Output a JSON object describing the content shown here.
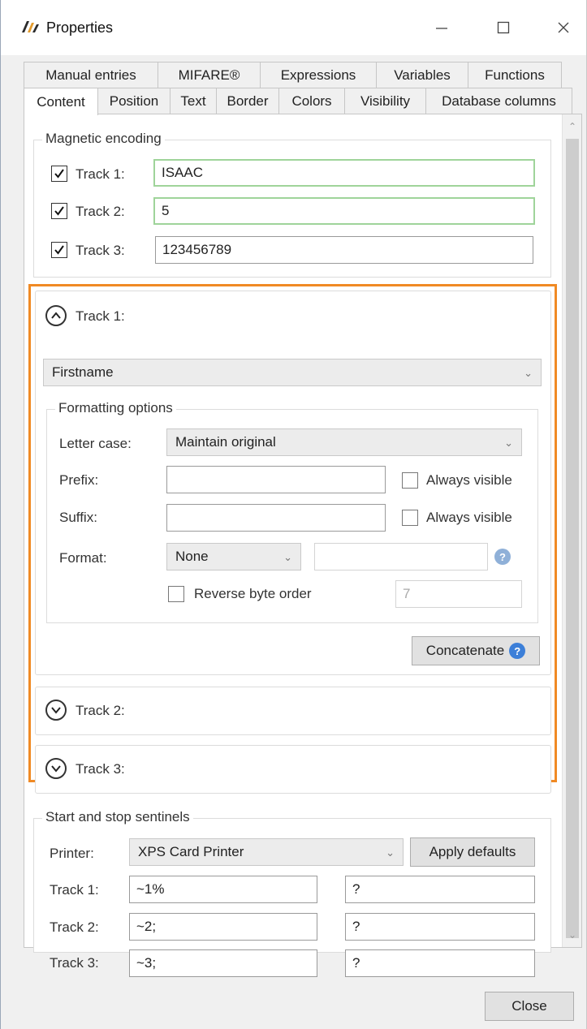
{
  "window": {
    "title": "Properties"
  },
  "tabs": {
    "back": [
      "Manual entries",
      "MIFARE®",
      "Expressions",
      "Variables",
      "Functions"
    ],
    "front": [
      "Content",
      "Position",
      "Text",
      "Border",
      "Colors",
      "Visibility",
      "Database columns"
    ]
  },
  "magnetic": {
    "title": "Magnetic encoding",
    "tracks": [
      {
        "label": "Track 1:",
        "value": "ISAAC"
      },
      {
        "label": "Track 2:",
        "value": "5"
      },
      {
        "label": "Track 3:",
        "value": "123456789"
      }
    ]
  },
  "track1": {
    "header": "Track 1:",
    "column": "Firstname",
    "formatting": {
      "title": "Formatting options",
      "letter_case_label": "Letter case:",
      "letter_case_value": "Maintain original",
      "prefix_label": "Prefix:",
      "suffix_label": "Suffix:",
      "always_visible": "Always visible",
      "format_label": "Format:",
      "format_value": "None",
      "reverse_label": "Reverse byte order",
      "reverse_value": "7"
    },
    "concatenate": "Concatenate"
  },
  "track2": {
    "header": "Track 2:"
  },
  "track3": {
    "header": "Track 3:"
  },
  "sentinels": {
    "title": "Start and stop sentinels",
    "printer_label": "Printer:",
    "printer_value": "XPS Card Printer",
    "apply_defaults": "Apply defaults",
    "rows": [
      {
        "label": "Track 1:",
        "start": "~1%",
        "end": "?"
      },
      {
        "label": "Track 2:",
        "start": "~2;",
        "end": "?"
      },
      {
        "label": "Track 3:",
        "start": "~3;",
        "end": "?"
      }
    ]
  },
  "footer": {
    "close": "Close"
  },
  "colors": {
    "highlight": "#f08a24",
    "valid_border": "#9fd49a",
    "help_blue": "#3c7fd8"
  }
}
